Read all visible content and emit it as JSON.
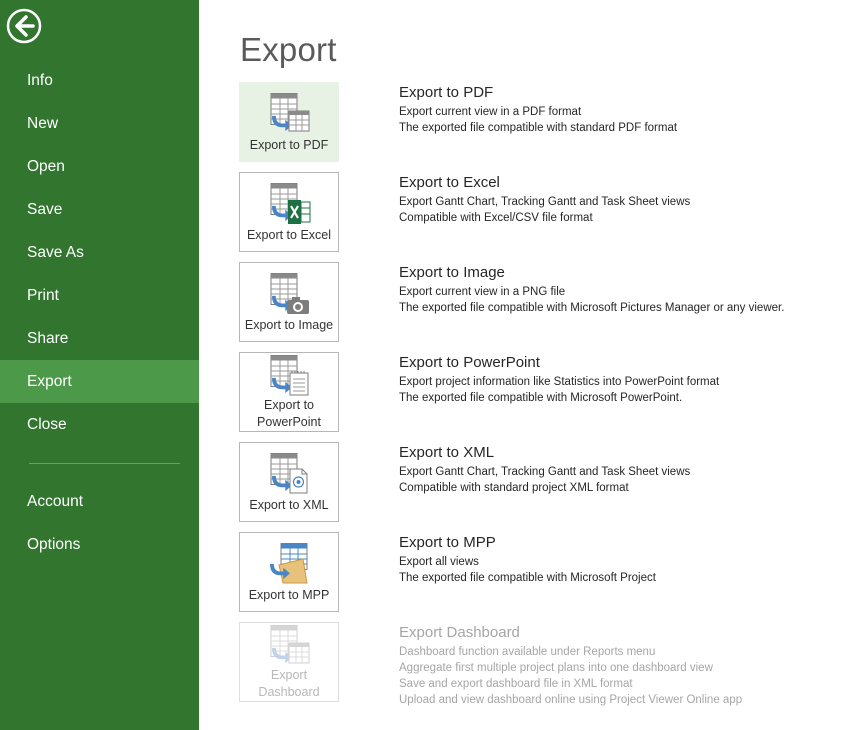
{
  "sidebar": {
    "items": [
      {
        "label": "Info"
      },
      {
        "label": "New"
      },
      {
        "label": "Open"
      },
      {
        "label": "Save"
      },
      {
        "label": "Save As"
      },
      {
        "label": "Print"
      },
      {
        "label": "Share"
      },
      {
        "label": "Export",
        "active": true
      },
      {
        "label": "Close"
      }
    ],
    "bottom_items": [
      {
        "label": "Account"
      },
      {
        "label": "Options"
      }
    ]
  },
  "main": {
    "title": "Export",
    "options": [
      {
        "tile_label": "Export to PDF",
        "title": "Export to PDF",
        "lines": [
          "Export current view in a PDF format",
          "The exported file compatible with standard PDF format"
        ],
        "icon": "pdf-export-icon",
        "state": "selected"
      },
      {
        "tile_label": "Export to Excel",
        "title": "Export to Excel",
        "lines": [
          "Export Gantt Chart, Tracking Gantt and Task Sheet views",
          "Compatible with Excel/CSV file format"
        ],
        "icon": "excel-export-icon",
        "state": "normal"
      },
      {
        "tile_label": "Export to Image",
        "title": "Export to Image",
        "lines": [
          "Export current view in a PNG file",
          "The exported file compatible with Microsoft Pictures Manager or any viewer."
        ],
        "icon": "image-export-icon",
        "state": "normal"
      },
      {
        "tile_label_1": "Export to",
        "tile_label_2": "PowerPoint",
        "title": "Export to PowerPoint",
        "lines": [
          "Export project information like Statistics into PowerPoint format",
          "The exported file compatible with Microsoft PowerPoint."
        ],
        "icon": "powerpoint-export-icon",
        "state": "normal"
      },
      {
        "tile_label": "Export to XML",
        "title": "Export to XML",
        "lines": [
          "Export Gantt Chart, Tracking Gantt and Task Sheet views",
          "Compatible with standard project XML format"
        ],
        "icon": "xml-export-icon",
        "state": "normal"
      },
      {
        "tile_label": "Export to MPP",
        "title": "Export to MPP",
        "lines": [
          "Export all views",
          "The exported file compatible with Microsoft Project"
        ],
        "icon": "mpp-export-icon",
        "state": "normal"
      },
      {
        "tile_label_1": "Export",
        "tile_label_2": "Dashboard",
        "title": "Export Dashboard",
        "lines": [
          "Dashboard function available under Reports menu",
          "Aggregate first multiple project plans into one dashboard view",
          "Save and export dashboard file in XML format",
          "Upload and view dashboard online using Project Viewer Online app"
        ],
        "icon": "dashboard-export-icon",
        "state": "disabled"
      }
    ]
  },
  "colors": {
    "sidebar_bg": "#31752f",
    "sidebar_active": "#4c9a49",
    "tile_selected": "#e8f2e4",
    "accent_arrow": "#4a86c5",
    "excel_green": "#1d7044",
    "disabled_text": "#a6a6a6"
  }
}
